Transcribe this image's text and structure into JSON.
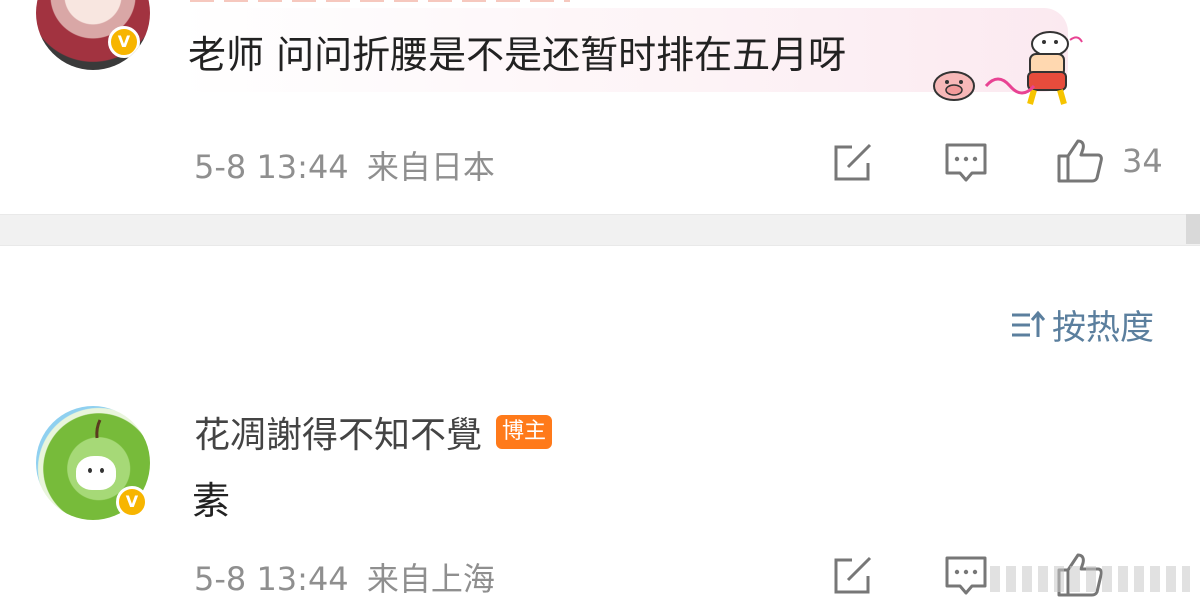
{
  "comment1": {
    "text": "老师  问问折腰是不是还暂时排在五月呀",
    "timestamp": "5-8 13:44",
    "location": "来自日本",
    "likes": "34",
    "avatar_badge": "V"
  },
  "sort": {
    "label": "按热度",
    "icon": "sort-icon"
  },
  "comment2": {
    "author": "花凋謝得不知不覺",
    "badge": "博主",
    "text": "素",
    "timestamp": "5-8 13:44",
    "location": "来自上海",
    "avatar_badge": "V"
  },
  "icons": {
    "repost": "share-square-icon",
    "comment": "comment-bubble-icon",
    "like": "thumbs-up-icon"
  },
  "colors": {
    "link_blue": "#5b7f9e",
    "blogger_badge": "#ff7a1a",
    "verified_badge": "#f7b500",
    "meta_gray": "#8f8f8f"
  }
}
